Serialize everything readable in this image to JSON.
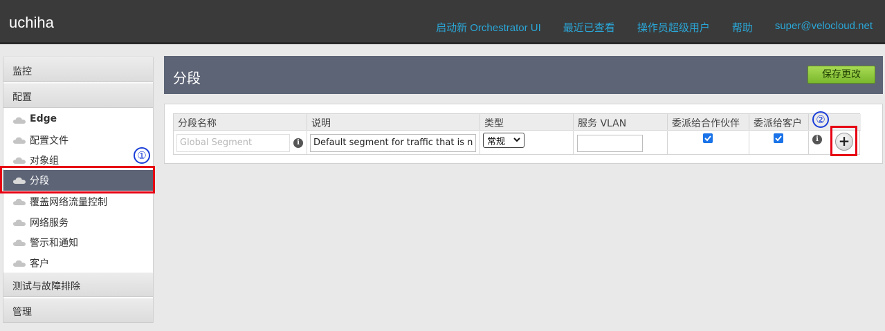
{
  "header": {
    "brand": "uchiha",
    "nav": [
      "启动新 Orchestrator UI",
      "最近已查看",
      "操作员超级用户",
      "帮助",
      "super@velocloud.net"
    ]
  },
  "sidebar": {
    "sections": {
      "monitor": "监控",
      "configure": "配置",
      "test": "测试与故障排除",
      "admin": "管理"
    },
    "items": [
      {
        "label": "Edge"
      },
      {
        "label": "配置文件"
      },
      {
        "label": "对象组"
      },
      {
        "label": "分段"
      },
      {
        "label": "覆盖网络流量控制"
      },
      {
        "label": "网络服务"
      },
      {
        "label": "警示和通知"
      },
      {
        "label": "客户"
      }
    ],
    "active_item": "分段"
  },
  "annotations": {
    "one": "①",
    "two": "②",
    "highlight_color": "#e60012",
    "circle_color": "#1a3dd8"
  },
  "main": {
    "title": "分段",
    "save_label": "保存更改",
    "columns": [
      "分段名称",
      "说明",
      "类型",
      "服务 VLAN",
      "委派给合作伙伴",
      "委派给客户"
    ],
    "row": {
      "name_placeholder": "Global Segment",
      "description": "Default segment for traffic that is n",
      "type": "常规",
      "service_vlan": "",
      "delegate_partner": true,
      "delegate_customer": true
    },
    "add_label": "+"
  },
  "colors": {
    "header_bg": "#3a3a3a",
    "link": "#2aa7d8",
    "title_bar": "#5d6476",
    "save_green": "#8cc63f"
  }
}
